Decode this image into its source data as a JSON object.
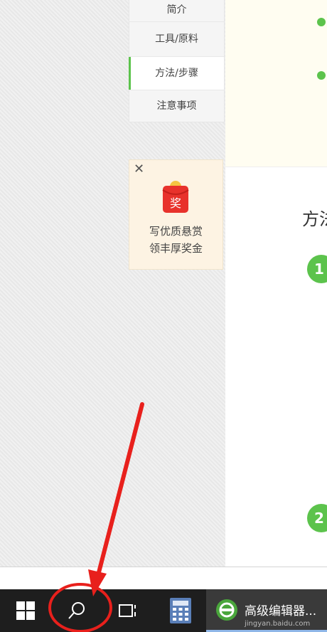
{
  "nav": {
    "items": [
      {
        "label": "简介"
      },
      {
        "label": "工具/原料"
      },
      {
        "label": "方法/步骤"
      },
      {
        "label": "注意事项"
      }
    ],
    "active_index": 2
  },
  "promo": {
    "badge": "奖",
    "line1": "写优质悬赏",
    "line2": "领丰厚奖金",
    "close_label": "✕"
  },
  "content": {
    "heading": "方法",
    "step1": "1",
    "step2": "2"
  },
  "taskbar": {
    "app_label": "高级编辑器...",
    "watermark": "jingyan.baidu.com"
  },
  "colors": {
    "accent_green": "#5cc34c",
    "annotation_red": "#e8201c",
    "taskbar": "#1e1e1e"
  },
  "icons": [
    "windows-start-icon",
    "search-icon",
    "task-view-icon",
    "calculator-icon",
    "app-icon"
  ]
}
